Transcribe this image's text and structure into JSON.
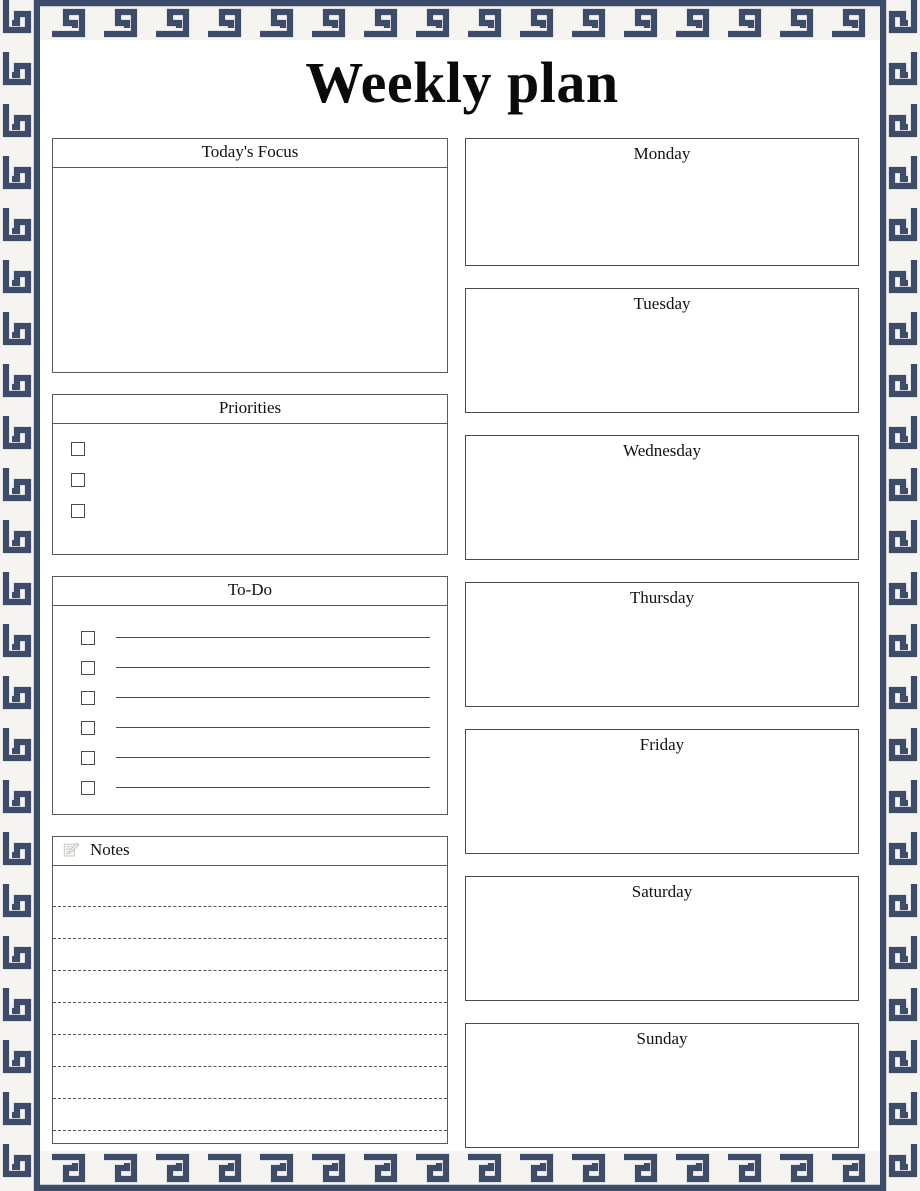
{
  "document": {
    "title": "Weekly plan"
  },
  "colors": {
    "border_navy": "#3e4c6b",
    "border_cream": "#f5f4f0",
    "box_outline": "#4a4a4a",
    "text": "#111111",
    "page_background": "#ffffff"
  },
  "border": {
    "pattern_name": "greek-key-meander"
  },
  "left_column": {
    "focus": {
      "heading": "Today's Focus"
    },
    "priorities": {
      "heading": "Priorities",
      "items": [
        {
          "checked": false,
          "text": ""
        },
        {
          "checked": false,
          "text": ""
        },
        {
          "checked": false,
          "text": ""
        }
      ]
    },
    "todo": {
      "heading": "To-Do",
      "items": [
        {
          "checked": false,
          "text": ""
        },
        {
          "checked": false,
          "text": ""
        },
        {
          "checked": false,
          "text": ""
        },
        {
          "checked": false,
          "text": ""
        },
        {
          "checked": false,
          "text": ""
        },
        {
          "checked": false,
          "text": ""
        }
      ]
    },
    "notes": {
      "heading": "Notes",
      "icon": "memo-pencil-icon",
      "line_count": 8,
      "lines": [
        "",
        "",
        "",
        "",
        "",
        "",
        "",
        ""
      ]
    }
  },
  "right_column": {
    "days": [
      {
        "name": "Monday",
        "content": ""
      },
      {
        "name": "Tuesday",
        "content": ""
      },
      {
        "name": "Wednesday",
        "content": ""
      },
      {
        "name": "Thursday",
        "content": ""
      },
      {
        "name": "Friday",
        "content": ""
      },
      {
        "name": "Saturday",
        "content": ""
      },
      {
        "name": "Sunday",
        "content": ""
      }
    ]
  }
}
